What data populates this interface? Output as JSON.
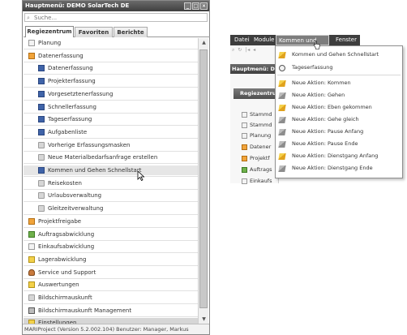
{
  "left": {
    "title": "Hauptmenü: DEMO SolarTech DE",
    "window_buttons": [
      "_",
      "□",
      "×"
    ],
    "search_placeholder": "Suche...",
    "search_icon": "magnifier-icon",
    "tabs": [
      "Regiezentrum",
      "Favoriten",
      "Berichte"
    ],
    "tree": [
      {
        "label": "Planung",
        "icon": "doc",
        "indent": 1
      },
      {
        "label": "Datenerfassung",
        "icon": "orange",
        "indent": 1
      },
      {
        "label": "Datenerfassung",
        "icon": "list",
        "indent": 2
      },
      {
        "label": "Projekterfassung",
        "icon": "list",
        "indent": 2
      },
      {
        "label": "Vorgesetztenerfassung",
        "icon": "list",
        "indent": 2
      },
      {
        "label": "Schnellerfassung",
        "icon": "list",
        "indent": 2
      },
      {
        "label": "Tageserfassung",
        "icon": "list",
        "indent": 2
      },
      {
        "label": "Aufgabenliste",
        "icon": "list",
        "indent": 2
      },
      {
        "label": "Vorherige Erfassungsmasken",
        "icon": "folder",
        "indent": 2
      },
      {
        "label": "Neue Materialbedarfsanfrage erstellen",
        "icon": "folder",
        "indent": 2
      },
      {
        "label": "Kommen und Gehen Schnellstart",
        "icon": "list",
        "indent": 2
      },
      {
        "label": "Reisekosten",
        "icon": "folder",
        "indent": 2
      },
      {
        "label": "Urlaubsverwaltung",
        "icon": "folder",
        "indent": 2
      },
      {
        "label": "Gleitzeitverwaltung",
        "icon": "folder",
        "indent": 2
      },
      {
        "label": "Projektfreigabe",
        "icon": "orange",
        "indent": 1
      },
      {
        "label": "Auftragsabwicklung",
        "icon": "green",
        "indent": 1
      },
      {
        "label": "Einkaufsabwicklung",
        "icon": "doc",
        "indent": 1
      },
      {
        "label": "Lagerabwicklung",
        "icon": "yellow",
        "indent": 1
      },
      {
        "label": "Service und Support",
        "icon": "person",
        "indent": 1
      },
      {
        "label": "Auswertungen",
        "icon": "yellow",
        "indent": 1
      },
      {
        "label": "Bildschirmauskunft",
        "icon": "folder",
        "indent": 1
      },
      {
        "label": "Bildschirmauskunft Management",
        "icon": "screen",
        "indent": 1
      },
      {
        "label": "Einstellungen",
        "icon": "yellow",
        "indent": 1
      }
    ],
    "selected_row": 10,
    "highlighted_row": 22,
    "status": "MARIProject (Version 5.2.002.104) Benutzer: Manager, Markus"
  },
  "right": {
    "menubar": [
      "Datei",
      "Module",
      "Kommen und Gehen",
      "Fenster"
    ],
    "active_menu": 2,
    "bg_toolbar": "⌕ ↻ |◂ ◂",
    "bg_title": "Hauptmenü: DEMO",
    "bg_tab": "Regiezentrum",
    "bg_rows": [
      {
        "label": "Stammd",
        "icon": "doc"
      },
      {
        "label": "Stammd",
        "icon": "doc"
      },
      {
        "label": "Planung",
        "icon": "doc"
      },
      {
        "label": "Datener",
        "icon": "orange"
      },
      {
        "label": "Projektf",
        "icon": "orange"
      },
      {
        "label": "Auftrags",
        "icon": "green"
      },
      {
        "label": "Einkaufs",
        "icon": "doc"
      }
    ],
    "dropdown": [
      {
        "label": "Kommen und Gehen Schnellstart",
        "icon": "pencil"
      },
      {
        "label": "Tageserfassung",
        "icon": "clock"
      },
      {
        "label": "Neue Aktion: Kommen",
        "icon": "pencil"
      },
      {
        "label": "Neue Aktion: Gehen",
        "icon": "pencil-gray"
      },
      {
        "label": "Neue Aktion: Eben gekommen",
        "icon": "pencil"
      },
      {
        "label": "Neue Aktion: Gehe gleich",
        "icon": "pencil-gray"
      },
      {
        "label": "Neue Aktion: Pause Anfang",
        "icon": "pencil-gray"
      },
      {
        "label": "Neue Aktion: Pause Ende",
        "icon": "pencil-gray"
      },
      {
        "label": "Neue Aktion: Dienstgang Anfang",
        "icon": "pencil"
      },
      {
        "label": "Neue Aktion: Dienstgang Ende",
        "icon": "pencil-gray"
      }
    ]
  }
}
